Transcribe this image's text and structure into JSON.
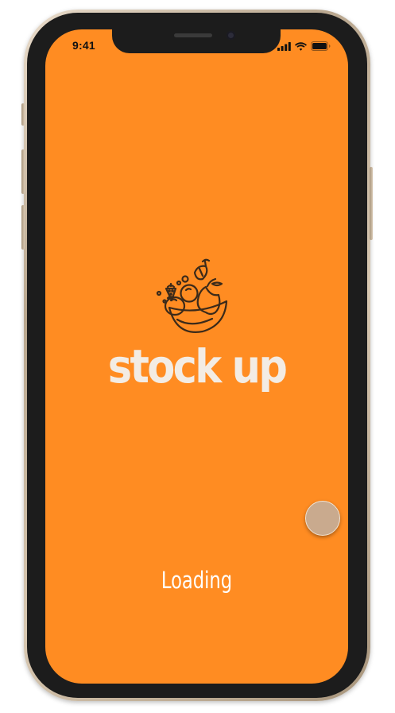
{
  "status_bar": {
    "time": "9:41",
    "icons": [
      "cellular-signal-icon",
      "wifi-icon",
      "battery-icon"
    ]
  },
  "app": {
    "logo_icon": "fruit-bowl-icon",
    "brand_name": "stock up",
    "loading_text": "Loading"
  },
  "colors": {
    "background": "#ff8c22",
    "brand_text": "#f3ece4",
    "logo_stroke": "#3b2a1a",
    "touch_indicator": "#c9aa8e"
  }
}
